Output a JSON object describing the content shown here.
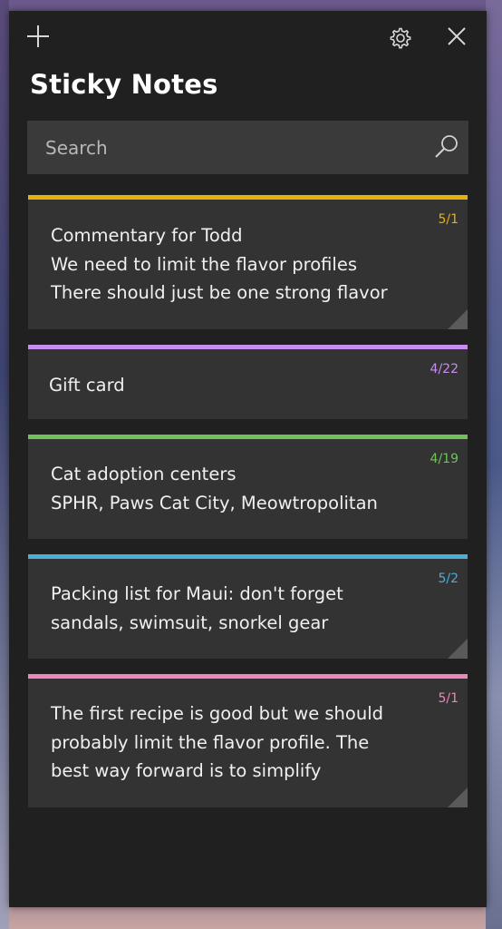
{
  "app": {
    "title": "Sticky Notes"
  },
  "titlebar": {
    "add_icon": "plus-icon",
    "settings_icon": "gear-icon",
    "close_icon": "close-icon"
  },
  "search": {
    "placeholder": "Search",
    "icon": "search-icon"
  },
  "notes": [
    {
      "date": "5/1",
      "color": "#e8b10a",
      "text": "Commentary for Todd\nWe need to limit the flavor profiles\nThere should just be one strong flavor"
    },
    {
      "date": "4/22",
      "color": "#c68cf0",
      "text": "Gift card"
    },
    {
      "date": "4/19",
      "color": "#6fc25a",
      "text": "Cat adoption centers\nSPHR, Paws Cat City, Meowtropolitan"
    },
    {
      "date": "5/2",
      "color": "#4aaed6",
      "text": "Packing list for Maui: don't forget\nsandals, swimsuit, snorkel gear"
    },
    {
      "date": "5/1",
      "color": "#ee86b9",
      "text": "The first recipe is good but we should\nprobably limit the flavor profile. The\nbest way forward is to simplify"
    }
  ]
}
